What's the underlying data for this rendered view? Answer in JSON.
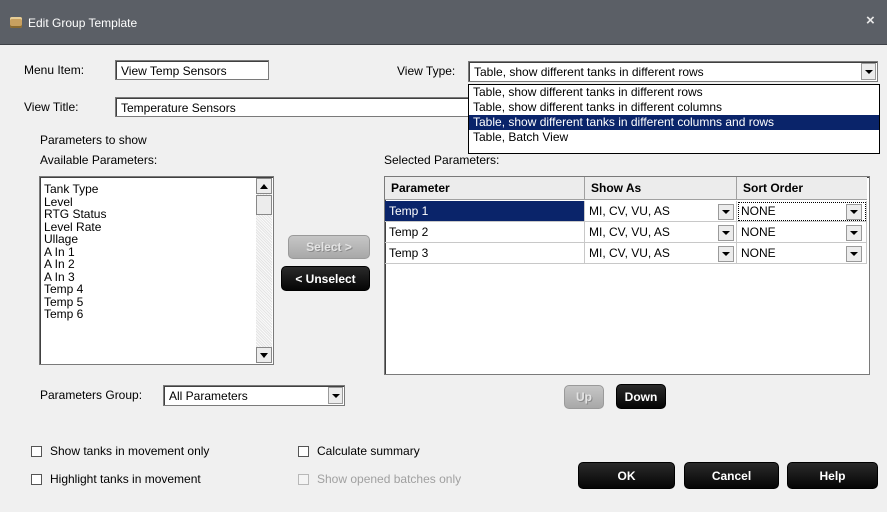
{
  "window": {
    "title": "Edit Group Template",
    "close_glyph": "×"
  },
  "form": {
    "menu_item_label": "Menu Item:",
    "menu_item_value": "View Temp Sensors",
    "view_title_label": "View Title:",
    "view_title_value": "Temperature Sensors",
    "view_type_label": "View Type:",
    "view_type_value": "Table, show different tanks in different rows",
    "view_type_options": [
      "Table, show different tanks in different rows",
      "Table, show different tanks in different columns",
      "Table, show different tanks in different columns and rows",
      "Table, Batch View"
    ],
    "view_type_highlighted_index": 2
  },
  "parameters": {
    "section_label": "Parameters to show",
    "available_label": "Available Parameters:",
    "available": [
      "Tank Type",
      "Level",
      "RTG Status",
      "Level Rate",
      "Ullage",
      "A In 1",
      "A In 2",
      "A In 3",
      "Temp 4",
      "Temp 5",
      "Temp 6"
    ],
    "selected_label": "Selected Parameters:",
    "group_label": "Parameters Group:",
    "group_value": "All Parameters"
  },
  "buttons": {
    "select": "Select >",
    "unselect": "< Unselect",
    "up": "Up",
    "down": "Down",
    "ok": "OK",
    "cancel": "Cancel",
    "help": "Help"
  },
  "grid": {
    "columns": [
      "Parameter",
      "Show As",
      "Sort Order"
    ],
    "rows": [
      {
        "parameter": "Temp 1",
        "show_as": "MI, CV, VU, AS",
        "sort_order": "NONE",
        "selected": true
      },
      {
        "parameter": "Temp 2",
        "show_as": "MI, CV, VU, AS",
        "sort_order": "NONE",
        "selected": false
      },
      {
        "parameter": "Temp 3",
        "show_as": "MI, CV, VU, AS",
        "sort_order": "NONE",
        "selected": false
      }
    ]
  },
  "options": {
    "show_movement_only": {
      "label": "Show tanks in movement only",
      "checked": false
    },
    "highlight_movement": {
      "label": "Highlight tanks in movement",
      "checked": false
    },
    "calculate_summary": {
      "label": "Calculate summary",
      "checked": false
    },
    "opened_batches_only": {
      "label": "Show opened batches only",
      "checked": false,
      "disabled": true
    }
  },
  "colors": {
    "titlebar": "#5b5f66",
    "selection": "#0a246a",
    "dialog_bg": "#f0f0f0"
  }
}
